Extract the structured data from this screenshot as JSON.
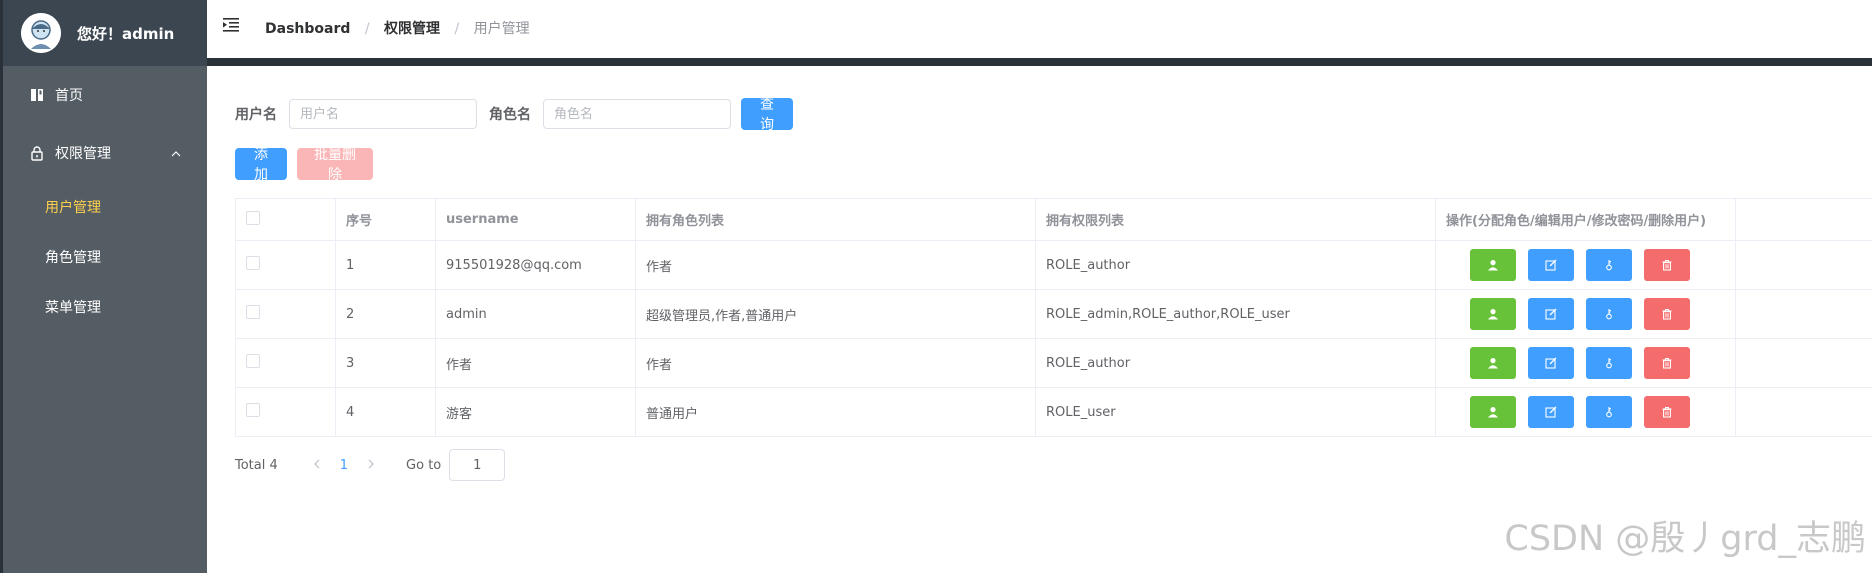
{
  "sidebar": {
    "greeting": "您好！admin",
    "menu": [
      {
        "label": "首页"
      },
      {
        "label": "权限管理"
      }
    ],
    "submenu": [
      {
        "label": "用户管理"
      },
      {
        "label": "角色管理"
      },
      {
        "label": "菜单管理"
      }
    ]
  },
  "breadcrumb": [
    "Dashboard",
    "权限管理",
    "用户管理"
  ],
  "search": {
    "username_label": "用户名",
    "username_placeholder": "用户名",
    "role_label": "角色名",
    "role_placeholder": "角色名",
    "query_button": "查询"
  },
  "toolbar": {
    "add_button": "添加",
    "batch_delete_button": "批量删除"
  },
  "table": {
    "columns": [
      "序号",
      "username",
      "拥有角色列表",
      "拥有权限列表",
      "操作(分配角色/编辑用户/修改密码/删除用户)"
    ],
    "rows": [
      {
        "no": "1",
        "username": "915501928@qq.com",
        "roles": "作者",
        "perms": "ROLE_author"
      },
      {
        "no": "2",
        "username": "admin",
        "roles": "超级管理员,作者,普通用户",
        "perms": "ROLE_admin,ROLE_author,ROLE_user"
      },
      {
        "no": "3",
        "username": "作者",
        "roles": "作者",
        "perms": "ROLE_author"
      },
      {
        "no": "4",
        "username": "游客",
        "roles": "普通用户",
        "perms": "ROLE_user"
      }
    ]
  },
  "pagination": {
    "total": "Total 4",
    "current": "1",
    "goto_label": "Go to",
    "goto_value": "1"
  },
  "watermark": "CSDN @殷丿grd_志鹏",
  "colors": {
    "sidebar_bg": "#545c64",
    "active_menu": "#ffd04b",
    "primary": "#409eff",
    "success": "#67c23a",
    "danger": "#f56c6c"
  }
}
